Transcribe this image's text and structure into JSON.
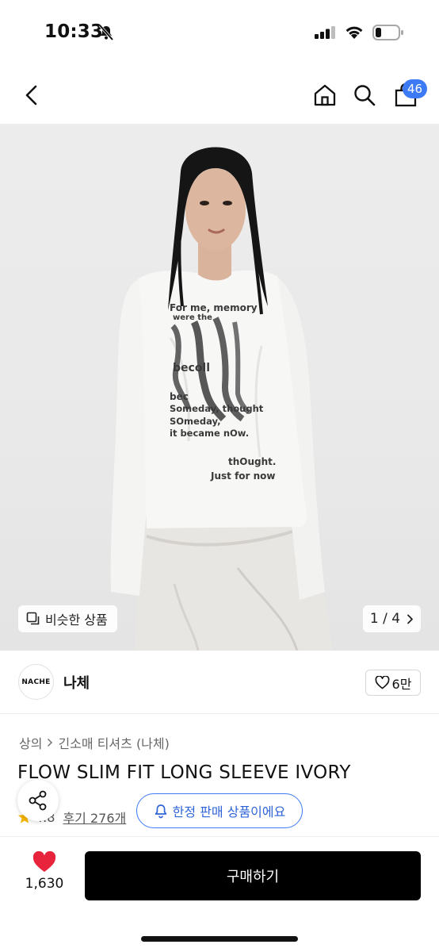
{
  "status_bar": {
    "time": "10:33"
  },
  "cart": {
    "count": "46"
  },
  "hero": {
    "print_lines": [
      "For me, memory",
      "were the",
      "becoll",
      "bec",
      "Someday, thought",
      "SOmeday,",
      "it became nOw.",
      "thOught.",
      "Just for now"
    ],
    "similar_label": "비슷한 상품",
    "page_current": "1",
    "page_total": "4",
    "page_separator": "/"
  },
  "brand": {
    "logo_text": "NACHE",
    "name": "나체",
    "likes": "6만"
  },
  "breadcrumb": {
    "category": "상의",
    "subcategory": "긴소매 티셔츠 (나체)"
  },
  "product": {
    "title": "FLOW SLIM FIT LONG SLEEVE IVORY",
    "rating": "4.8",
    "reviews": "후기 276개",
    "limited_label": "한정 판매 상품이에요"
  },
  "bottom": {
    "wish_count": "1,630",
    "buy_label": "구매하기"
  },
  "colors": {
    "accent": "#3d7bf6",
    "wish": "#e8243c",
    "buy_bg": "#000000",
    "star": "#f5b400"
  }
}
